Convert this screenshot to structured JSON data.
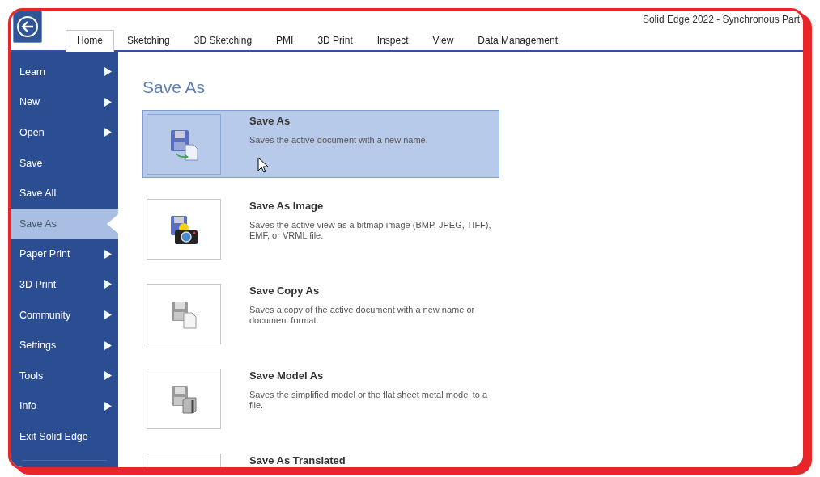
{
  "window": {
    "title": "Solid Edge 2022 - Synchronous Part"
  },
  "tabs": [
    {
      "label": "Home",
      "selected": true
    },
    {
      "label": "Sketching",
      "selected": false
    },
    {
      "label": "3D Sketching",
      "selected": false
    },
    {
      "label": "PMI",
      "selected": false
    },
    {
      "label": "3D Print",
      "selected": false
    },
    {
      "label": "Inspect",
      "selected": false
    },
    {
      "label": "View",
      "selected": false
    },
    {
      "label": "Data Management",
      "selected": false
    }
  ],
  "sidebar": {
    "items": [
      {
        "label": "Learn",
        "submenu": true,
        "selected": false
      },
      {
        "label": "New",
        "submenu": true,
        "selected": false
      },
      {
        "label": "Open",
        "submenu": true,
        "selected": false
      },
      {
        "label": "Save",
        "submenu": false,
        "selected": false
      },
      {
        "label": "Save All",
        "submenu": false,
        "selected": false
      },
      {
        "label": "Save As",
        "submenu": false,
        "selected": true
      },
      {
        "label": "Paper Print",
        "submenu": true,
        "selected": false
      },
      {
        "label": "3D Print",
        "submenu": true,
        "selected": false
      },
      {
        "label": "Community",
        "submenu": true,
        "selected": false
      },
      {
        "label": "Settings",
        "submenu": true,
        "selected": false
      },
      {
        "label": "Tools",
        "submenu": true,
        "selected": false
      },
      {
        "label": "Info",
        "submenu": true,
        "selected": false
      },
      {
        "label": "Exit Solid Edge",
        "submenu": false,
        "selected": false
      }
    ]
  },
  "content": {
    "heading": "Save As",
    "options": [
      {
        "kind": "document",
        "title": "Save As",
        "description": "Saves the active document with a new name.",
        "selected": true
      },
      {
        "kind": "camera",
        "title": "Save As Image",
        "description": "Saves the active view as a bitmap image (BMP, JPEG, TIFF), EMF, or VRML file.",
        "selected": false
      },
      {
        "kind": "copy",
        "title": "Save Copy As",
        "description": "Saves a copy of the active document with a new name or document format.",
        "selected": false
      },
      {
        "kind": "model",
        "title": "Save Model As",
        "description": "Saves the simplified model or the flat sheet metal model to a file.",
        "selected": false
      },
      {
        "kind": "hidden",
        "title": "Save As Translated",
        "selected": false
      }
    ]
  }
}
